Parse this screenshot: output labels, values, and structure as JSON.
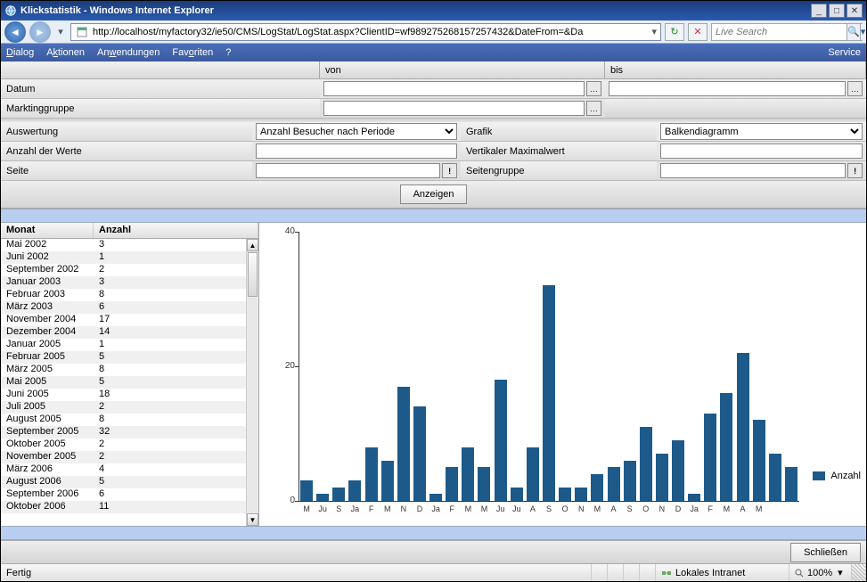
{
  "window": {
    "title": "Klickstatistik - Windows Internet Explorer"
  },
  "nav": {
    "url": "http://localhost/myfactory32/ie50/CMS/LogStat/LogStat.aspx?ClientID=wf989275268157257432&DateFrom=&Da",
    "search_placeholder": "Live Search"
  },
  "menu": {
    "items": [
      "Dialog",
      "Aktionen",
      "Anwendungen",
      "Favoriten",
      "?"
    ],
    "right": "Service"
  },
  "header": {
    "von": "von",
    "bis": "bis"
  },
  "filters": {
    "datum": "Datum",
    "marketinggruppe": "Marktinggruppe",
    "auswertung_label": "Auswertung",
    "auswertung_value": "Anzahl Besucher nach Periode",
    "grafik_label": "Grafik",
    "grafik_value": "Balkendiagramm",
    "anzahlwerte": "Anzahl der Werte",
    "vertmax": "Vertikaler Maximalwert",
    "seite": "Seite",
    "seitengruppe": "Seitengruppe",
    "anzeigen": "Anzeigen"
  },
  "table": {
    "col1": "Monat",
    "col2": "Anzahl",
    "rows": [
      {
        "m": "Mai 2002",
        "v": "3"
      },
      {
        "m": "Juni 2002",
        "v": "1"
      },
      {
        "m": "September 2002",
        "v": "2"
      },
      {
        "m": "Januar 2003",
        "v": "3"
      },
      {
        "m": "Februar 2003",
        "v": "8"
      },
      {
        "m": "März 2003",
        "v": "6"
      },
      {
        "m": "November 2004",
        "v": "17"
      },
      {
        "m": "Dezember 2004",
        "v": "14"
      },
      {
        "m": "Januar 2005",
        "v": "1"
      },
      {
        "m": "Februar 2005",
        "v": "5"
      },
      {
        "m": "März 2005",
        "v": "8"
      },
      {
        "m": "Mai 2005",
        "v": "5"
      },
      {
        "m": "Juni 2005",
        "v": "18"
      },
      {
        "m": "Juli 2005",
        "v": "2"
      },
      {
        "m": "August 2005",
        "v": "8"
      },
      {
        "m": "September 2005",
        "v": "32"
      },
      {
        "m": "Oktober 2005",
        "v": "2"
      },
      {
        "m": "November 2005",
        "v": "2"
      },
      {
        "m": "März 2006",
        "v": "4"
      },
      {
        "m": "August 2006",
        "v": "5"
      },
      {
        "m": "September 2006",
        "v": "6"
      },
      {
        "m": "Oktober 2006",
        "v": "11"
      }
    ]
  },
  "chart_data": {
    "type": "bar",
    "title": "",
    "xlabel": "",
    "ylabel": "",
    "ylim": [
      0,
      40
    ],
    "yticks": [
      0,
      20,
      40
    ],
    "legend": "Anzahl",
    "categories": [
      "M",
      "Ju",
      "S",
      "Ja",
      "F",
      "M",
      "N",
      "D",
      "Ja",
      "F",
      "M",
      "M",
      "Ju",
      "Ju",
      "A",
      "S",
      "O",
      "N",
      "M",
      "A",
      "S",
      "O",
      "N",
      "D",
      "Ja",
      "F",
      "M",
      "A",
      "M"
    ],
    "values": [
      3,
      1,
      2,
      3,
      8,
      6,
      17,
      14,
      1,
      5,
      8,
      5,
      18,
      2,
      8,
      32,
      2,
      2,
      4,
      5,
      6,
      11,
      7,
      9,
      1,
      13,
      16,
      22,
      12,
      7,
      5
    ]
  },
  "bottom": {
    "close": "Schließen"
  },
  "status": {
    "left": "Fertig",
    "zone": "Lokales Intranet",
    "zoom": "100%"
  }
}
